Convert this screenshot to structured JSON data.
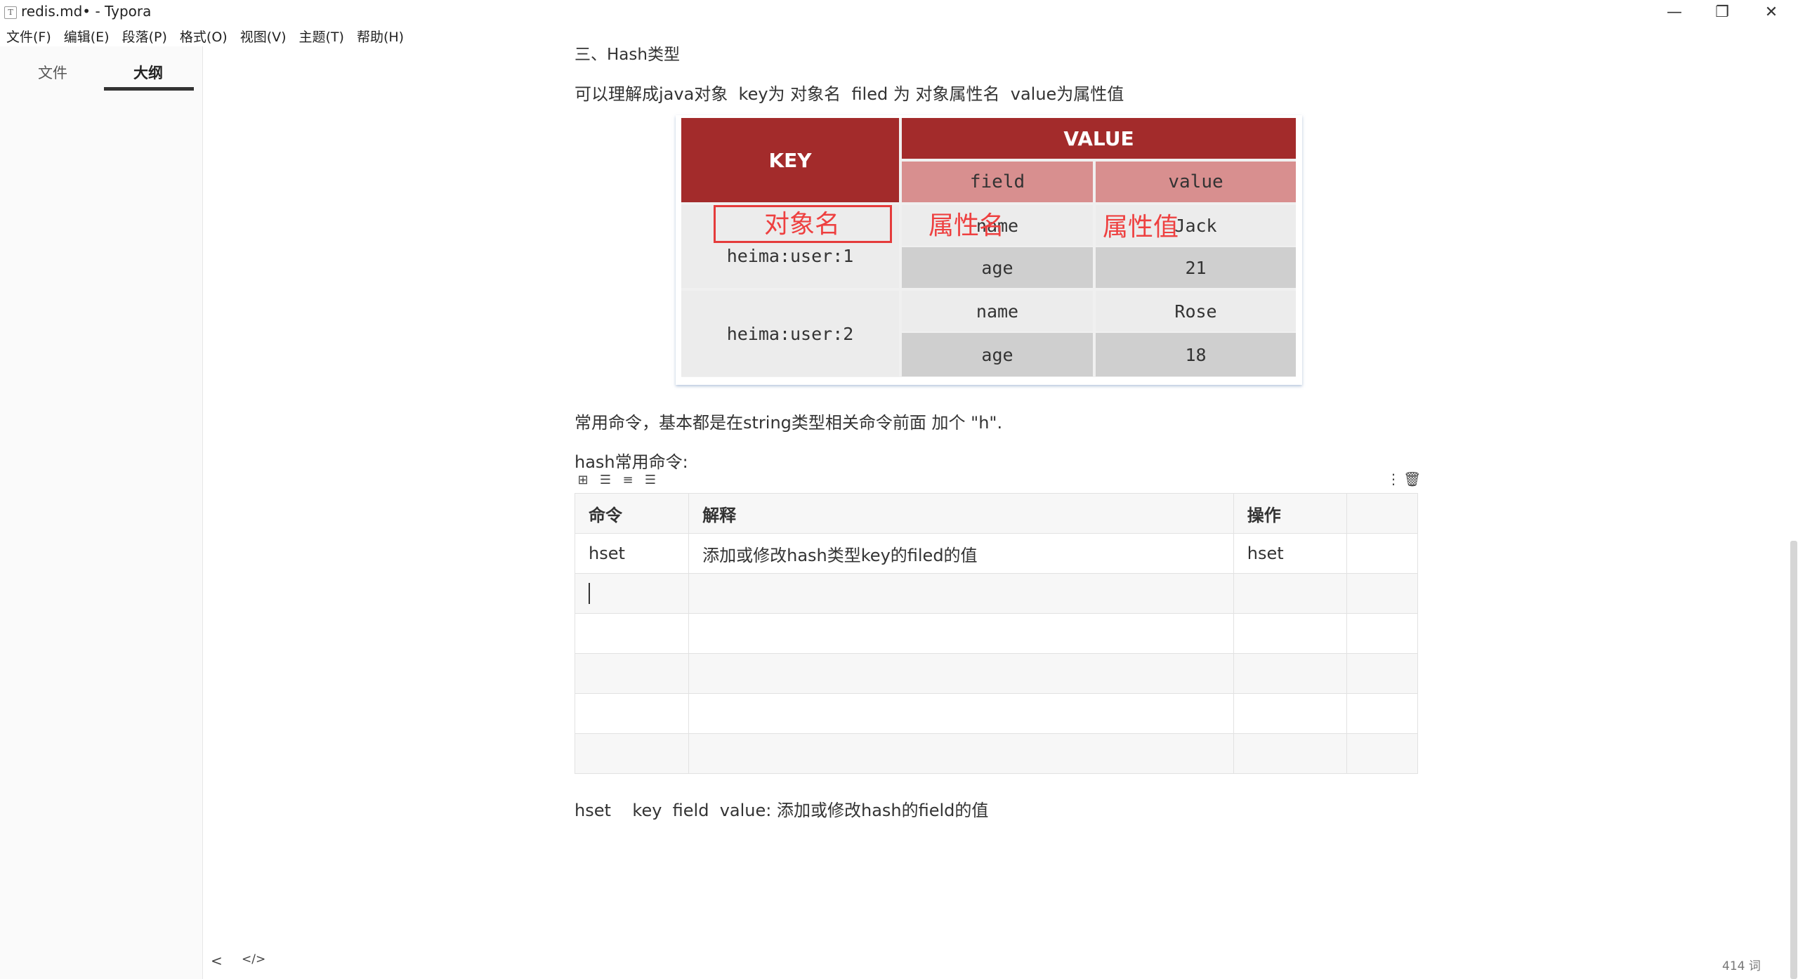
{
  "window": {
    "title": "redis.md• - Typora",
    "icon_letter": "T",
    "minimize": "—",
    "maximize": "❐",
    "close": "✕"
  },
  "menu": [
    "文件(F)",
    "编辑(E)",
    "段落(P)",
    "格式(O)",
    "视图(V)",
    "主题(T)",
    "帮助(H)"
  ],
  "sidebar": {
    "tabs": [
      {
        "label": "文件",
        "active": false
      },
      {
        "label": "大纲",
        "active": true
      }
    ],
    "footer_back": "<",
    "footer_code": "</>"
  },
  "doc": {
    "heading": "三、Hash类型",
    "para1": "可以理解成java对象  key为 对象名  filed 为 对象属性名  value为属性值",
    "image": {
      "key_header": "KEY",
      "value_header": "VALUE",
      "field_header": "field",
      "value_subheader": "value",
      "rows": [
        {
          "key": "heima:user:1",
          "fields": [
            [
              "name",
              "Jack"
            ],
            [
              "age",
              "21"
            ]
          ]
        },
        {
          "key": "heima:user:2",
          "fields": [
            [
              "name",
              "Rose"
            ],
            [
              "age",
              "18"
            ]
          ]
        }
      ],
      "annotations": {
        "object_name": "对象名",
        "attr_name": "属性名",
        "attr_value": "属性值"
      }
    },
    "para2": "常用命令，基本都是在string类型相关命令前面 加个 \"h\".",
    "para3": "hash常用命令:",
    "table": {
      "headers": [
        "命令",
        "解释",
        "操作",
        ""
      ],
      "rows": [
        [
          "hset",
          "添加或修改hash类型key的filed的值",
          "hset",
          ""
        ],
        [
          "",
          "",
          "",
          ""
        ],
        [
          "",
          "",
          "",
          ""
        ],
        [
          "",
          "",
          "",
          ""
        ],
        [
          "",
          "",
          "",
          ""
        ],
        [
          "",
          "",
          "",
          ""
        ]
      ]
    },
    "para4": "hset    key  field  value: 添加或修改hash的field的值"
  },
  "status": {
    "word_count": "414 词"
  }
}
